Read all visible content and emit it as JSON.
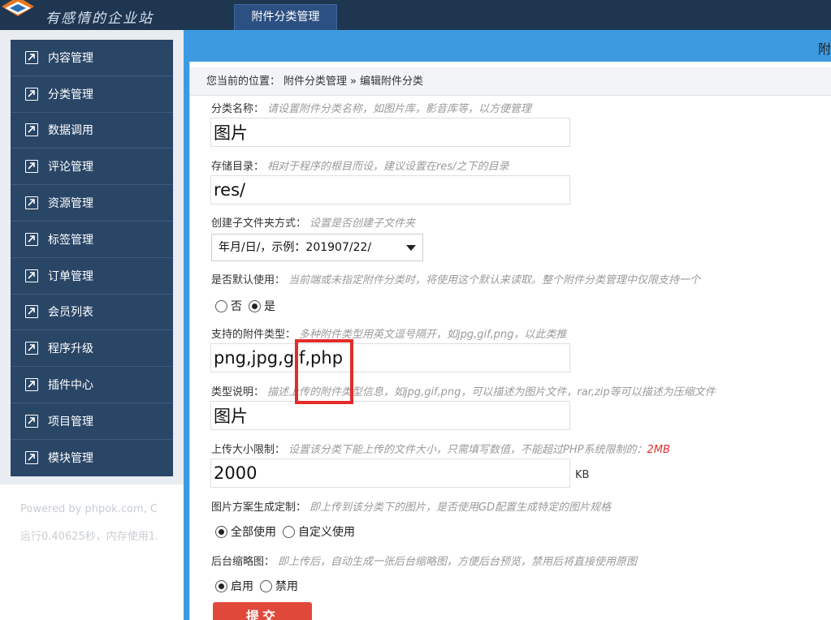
{
  "header": {
    "logo_text": "有感情的企业站",
    "tab_label": "附件分类管理",
    "panel_title": "附"
  },
  "sidebar": {
    "items": [
      {
        "label": "内容管理"
      },
      {
        "label": "分类管理"
      },
      {
        "label": "数据调用"
      },
      {
        "label": "评论管理"
      },
      {
        "label": "资源管理"
      },
      {
        "label": "标签管理"
      },
      {
        "label": "订单管理"
      },
      {
        "label": "会员列表"
      },
      {
        "label": "程序升级"
      },
      {
        "label": "插件中心"
      },
      {
        "label": "项目管理"
      },
      {
        "label": "模块管理"
      }
    ]
  },
  "footer": {
    "powered": "Powered by phpok.com, C",
    "runtime": "运行0.40625秒，内存使用1."
  },
  "breadcrumb": {
    "prefix": "您当前的位置：",
    "level1": "附件分类管理",
    "sep": "»",
    "level2": "编辑附件分类"
  },
  "form": {
    "name": {
      "label": "分类名称：",
      "hint": "请设置附件分类名称，如图片库，影音库等，以方便管理",
      "value": "图片"
    },
    "folder": {
      "label": "存储目录：",
      "hint": "相对于程序的根目而设，建议设置在res/之下的目录",
      "value": "res/"
    },
    "subfolder": {
      "label": "创建子文件夹方式：",
      "hint": "设置是否创建子文件夹",
      "selected": "年月/日/，示例：201907/22/"
    },
    "default": {
      "label": "是否默认使用：",
      "hint": "当前端或未指定附件分类时，将使用这个默认来读取。整个附件分类管理中仅限支持一个",
      "options": [
        "否",
        "是"
      ],
      "selected": "是"
    },
    "types": {
      "label": "支持的附件类型：",
      "hint": "多种附件类型用英文逗号隔开，如jpg,gif,png，以此类推",
      "value": "png,jpg,gif,php"
    },
    "typeinfo": {
      "label": "类型说明：",
      "hint": "描述上传的附件类型信息，如jpg,gif,png，可以描述为图片文件，rar,zip等可以描述为压缩文件",
      "value": "图片"
    },
    "maxsize": {
      "label": "上传大小限制：",
      "hint": "设置该分类下能上传的文件大小，只需填写数值，不能超过PHP系统限制的：",
      "hint_limit": "2MB",
      "value": "2000",
      "unit": "KB"
    },
    "gd": {
      "label": "图片方案生成定制：",
      "hint": "即上传到该分类下的图片，是否使用GD配置生成特定的图片规格",
      "options": [
        "全部使用",
        "自定义使用"
      ],
      "selected": "全部使用"
    },
    "thumb": {
      "label": "后台缩略图：",
      "hint": "即上传后，自动生成一张后台缩略图，方便后台预览，禁用后将直接使用原图",
      "options": [
        "启用",
        "禁用"
      ],
      "selected": "启用"
    },
    "submit_label": "提交"
  },
  "colors": {
    "topbar": "#1f3651",
    "sidebar": "#2a4667",
    "panel_blue": "#3c9ae0",
    "submit": "#e0493a",
    "highlight": "#e32b2b"
  }
}
